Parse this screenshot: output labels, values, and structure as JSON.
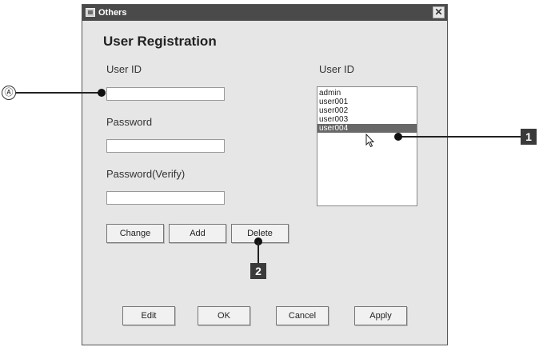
{
  "window": {
    "title": "Others",
    "close_symbol": "✕"
  },
  "heading": "User Registration",
  "left_form": {
    "user_id_label": "User ID",
    "user_id_value": "",
    "password_label": "Password",
    "password_value": "",
    "password_verify_label": "Password(Verify)",
    "password_verify_value": ""
  },
  "list": {
    "label": "User ID",
    "items": [
      "admin",
      "user001",
      "user002",
      "user003",
      "user004"
    ],
    "selected_index": 4
  },
  "action_buttons": {
    "change": "Change",
    "add": "Add",
    "delete": "Delete"
  },
  "bottom_buttons": {
    "edit": "Edit",
    "ok": "OK",
    "cancel": "Cancel",
    "apply": "Apply"
  },
  "callouts": {
    "a": "Ⓐ",
    "one": "1",
    "two": "2"
  },
  "colors": {
    "titlebar": "#4a4a4a",
    "dialog_bg": "#e6e6e6",
    "selection": "#686868",
    "callout": "#3a3a3a"
  }
}
